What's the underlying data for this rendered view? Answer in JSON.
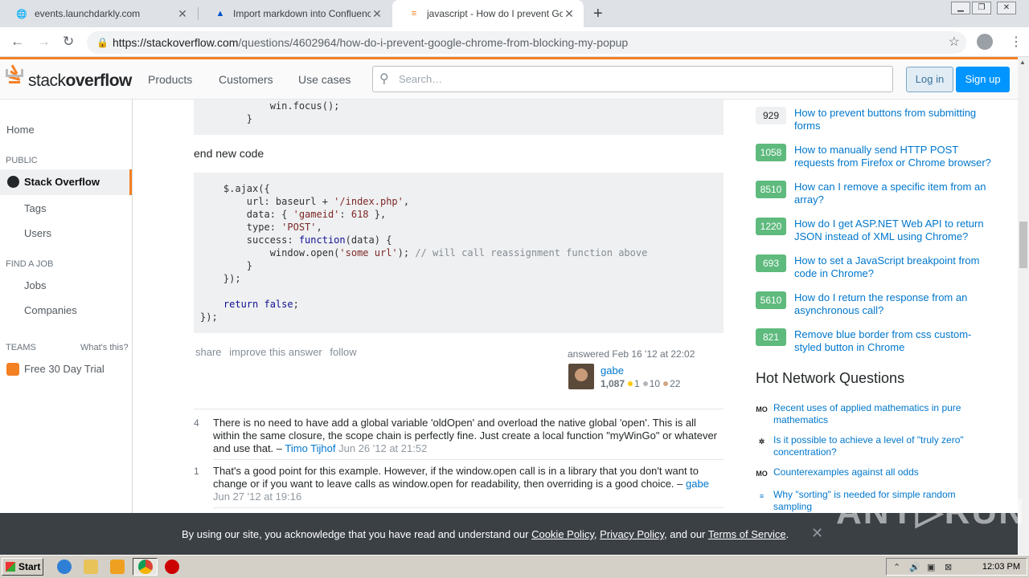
{
  "browser": {
    "tabs": [
      {
        "title": "events.launchdarkly.com",
        "favicon": "globe-icon"
      },
      {
        "title": "Import markdown into Confluence",
        "favicon": "atlassian-icon"
      },
      {
        "title": "javascript - How do I prevent Googl",
        "favicon": "stackoverflow-icon"
      }
    ],
    "url_host": "https://stackoverflow.com",
    "url_path": "/questions/4602964/how-do-i-prevent-google-chrome-from-blocking-my-popup"
  },
  "header": {
    "logo_light": "stack",
    "logo_bold": "overflow",
    "nav": [
      "Products",
      "Customers",
      "Use cases"
    ],
    "search_placeholder": "Search…",
    "login": "Log in",
    "signup": "Sign up"
  },
  "left_nav": {
    "home": "Home",
    "public_heading": "PUBLIC",
    "active": "Stack Overflow",
    "tags": "Tags",
    "users": "Users",
    "job_heading": "FIND A JOB",
    "jobs": "Jobs",
    "companies": "Companies",
    "teams_heading": "TEAMS",
    "whats_this": "What's this?",
    "trial": "Free 30 Day Trial"
  },
  "answer": {
    "end_text": "end new code",
    "menu": [
      "share",
      "improve this answer",
      "follow"
    ],
    "answered": "answered Feb 16 '12 at 22:02",
    "user": "gabe",
    "rep": "1,087",
    "gold": "1",
    "silver": "10",
    "bronze": "22"
  },
  "comments": [
    {
      "score": "4",
      "text": "There is no need to have add a global variable 'oldOpen' and overload the native global 'open'. This is all within the same closure, the scope chain is perfectly fine. Just create a local function \"myWinGo\" or whatever and use that. –",
      "user": "Timo Tijhof",
      "date": "Jun 26 '12 at 21:52"
    },
    {
      "score": "1",
      "text": "That's a good point for this example. However, if the window.open call is in a library that you don't want to change or if you want to leave calls as window.open for readability, then overriding is a good choice. –",
      "user": "gabe",
      "date": "Jun 27 '12 at 19:16"
    }
  ],
  "linked": [
    {
      "count": "929",
      "title": "How to prevent buttons from submitting forms",
      "accepted": false
    },
    {
      "count": "1058",
      "title": "How to manually send HTTP POST requests from Firefox or Chrome browser?",
      "accepted": true
    },
    {
      "count": "8510",
      "title": "How can I remove a specific item from an array?",
      "accepted": true
    },
    {
      "count": "1220",
      "title": "How do I get ASP.NET Web API to return JSON instead of XML using Chrome?",
      "accepted": true
    },
    {
      "count": "693",
      "title": "How to set a JavaScript breakpoint from code in Chrome?",
      "accepted": true
    },
    {
      "count": "5610",
      "title": "How do I return the response from an asynchronous call?",
      "accepted": true
    },
    {
      "count": "821",
      "title": "Remove blue border from css custom-styled button in Chrome",
      "accepted": true
    }
  ],
  "hnq": {
    "title": "Hot Network Questions",
    "items": [
      {
        "site": "MO",
        "title": "Recent uses of applied mathematics in pure mathematics"
      },
      {
        "site": "✲",
        "title": "Is it possible to achieve a level of \"truly zero\" concentration?"
      },
      {
        "site": "MO",
        "title": "Counterexamples against all odds"
      },
      {
        "site": "≡",
        "title": "Why \"sorting\" is needed for simple random sampling"
      }
    ]
  },
  "cookie": {
    "pre": "By using our site, you acknowledge that you have read and understand our",
    "policy": "Cookie Policy",
    "privacy": "Privacy Policy",
    "and": ", and our",
    "terms": "Terms of Service",
    "close": "✕"
  },
  "taskbar": {
    "start": "Start",
    "clock": "12:03 PM"
  }
}
